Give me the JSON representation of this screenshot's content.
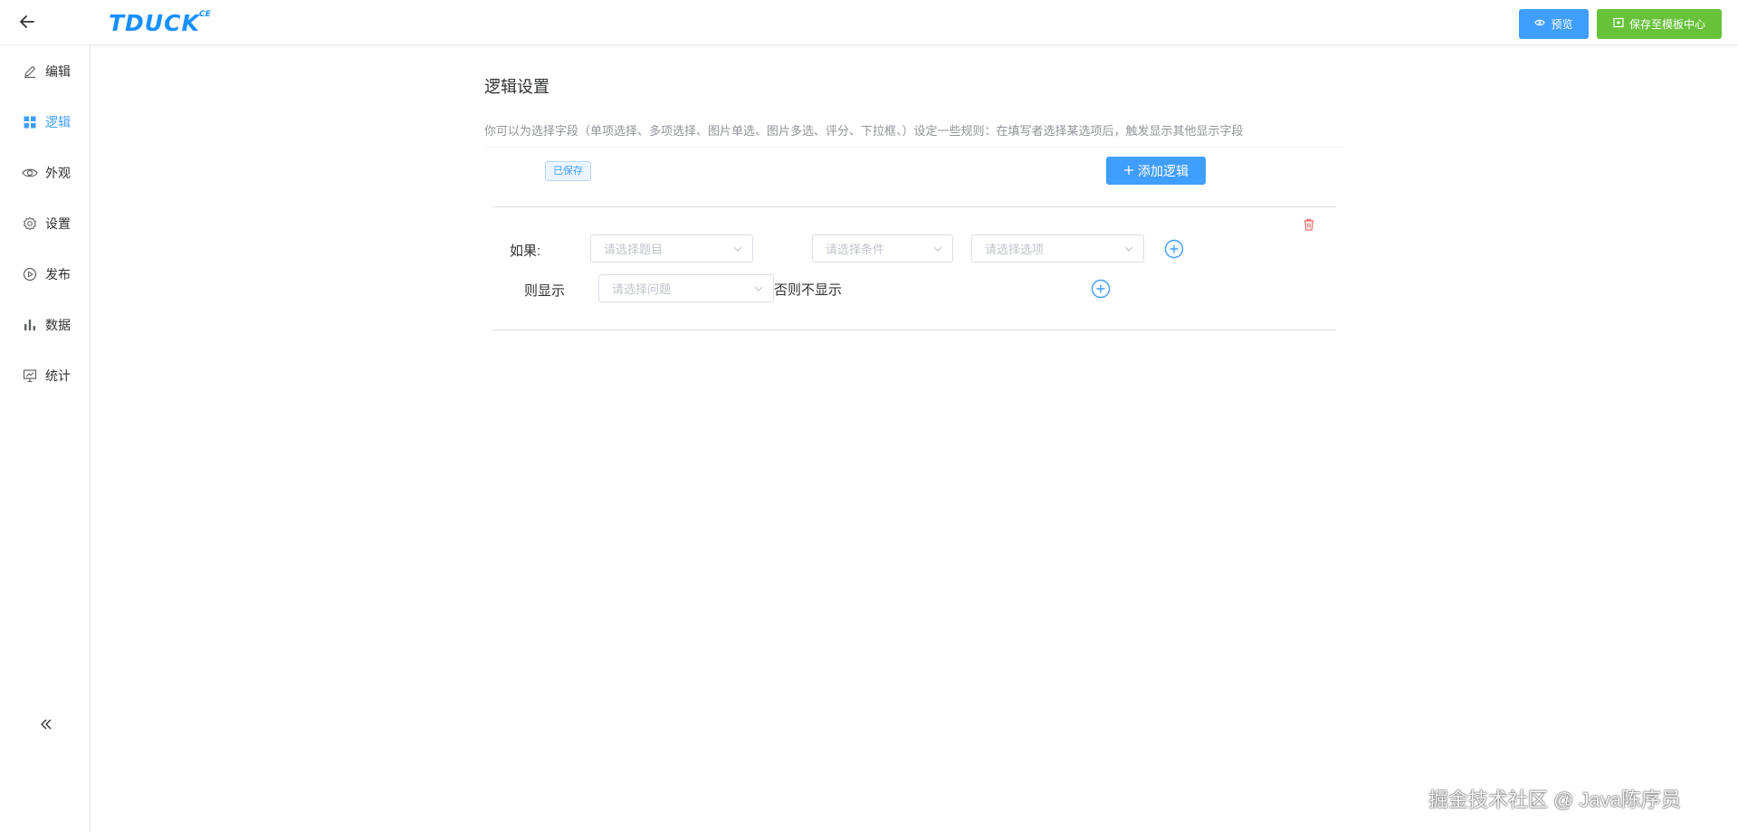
{
  "header": {
    "logo_text": "TDUCK",
    "logo_sup": "CE",
    "preview_label": "预览",
    "save_template_label": "保存至模板中心"
  },
  "sidebar": {
    "items": [
      {
        "label": "编辑",
        "icon": "edit-icon"
      },
      {
        "label": "逻辑",
        "icon": "grid-icon",
        "active": true
      },
      {
        "label": "外观",
        "icon": "eye-icon"
      },
      {
        "label": "设置",
        "icon": "gear-icon"
      },
      {
        "label": "发布",
        "icon": "play-icon"
      },
      {
        "label": "数据",
        "icon": "bar-chart-icon"
      },
      {
        "label": "统计",
        "icon": "presentation-icon"
      }
    ],
    "collapse_icon": "double-chevron-left-icon"
  },
  "main": {
    "title": "逻辑设置",
    "description": "你可以为选择字段（单项选择、多项选择、图片单选、图片多选、评分、下拉框、）设定一些规则：在填写者选择某选项后，触发显示其他显示字段",
    "saved_tag": "已保存",
    "add_logic_label": "添加逻辑"
  },
  "rule": {
    "if_label": "如果:",
    "question_placeholder": "请选择题目",
    "condition_placeholder": "请选择条件",
    "option_placeholder": "请选择选项",
    "then_label": "则显示",
    "show_question_placeholder": "请选择问题",
    "else_text": "否则不显示"
  },
  "colors": {
    "primary": "#409eff",
    "success": "#67c23a",
    "danger": "#f56c6c"
  },
  "watermark": "掘金技术社区 @ Java陈序员"
}
